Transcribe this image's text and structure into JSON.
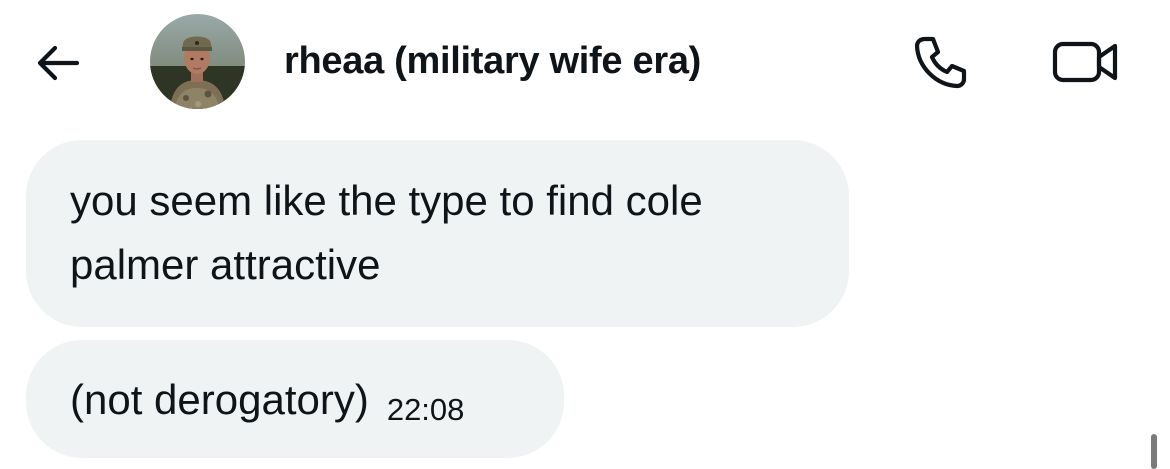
{
  "header": {
    "title": "rheaa (military wife era)",
    "back_icon": "arrow-left-icon",
    "call_icon": "phone-icon",
    "video_icon": "video-camera-icon",
    "avatar_alt": "profile photo"
  },
  "messages": [
    {
      "text": "you seem like the type to find cole palmer attractive",
      "timestamp": ""
    },
    {
      "text": "(not derogatory)",
      "timestamp": "22:08"
    }
  ],
  "colors": {
    "bubble_background": "#eff3f4",
    "text": "#0f1419",
    "page_background": "#ffffff"
  }
}
